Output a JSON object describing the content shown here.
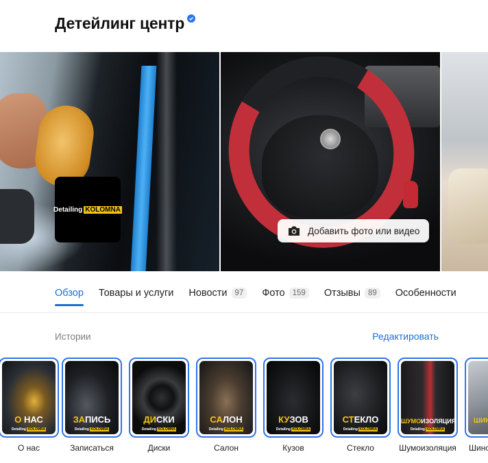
{
  "header": {
    "title": "Детейлинг центр"
  },
  "gallery": {
    "logo": {
      "text": "Detailing",
      "highlight": "KOLOMNA"
    },
    "add_media_label": "Добавить фото или видео"
  },
  "tabs": [
    {
      "label": "Обзор",
      "count": null,
      "active": true
    },
    {
      "label": "Товары и услуги",
      "count": null
    },
    {
      "label": "Новости",
      "count": "97"
    },
    {
      "label": "Фото",
      "count": "159"
    },
    {
      "label": "Отзывы",
      "count": "89"
    },
    {
      "label": "Особенности",
      "count": null
    }
  ],
  "stories": {
    "title": "Истории",
    "edit_label": "Редактировать",
    "brand_text": "Detailing",
    "brand_highlight": "KOLOMNA",
    "items": [
      {
        "label": "О нас",
        "accent": "О",
        "rest": " НАС"
      },
      {
        "label": "Записаться",
        "accent": "ЗА",
        "rest": "ПИСЬ"
      },
      {
        "label": "Диски",
        "accent": "ДИ",
        "rest": "СКИ"
      },
      {
        "label": "Салон",
        "accent": "СА",
        "rest": "ЛОН"
      },
      {
        "label": "Кузов",
        "accent": "КУ",
        "rest": "ЗОВ"
      },
      {
        "label": "Стекло",
        "accent": "СТ",
        "rest": "ЕКЛО"
      },
      {
        "label": "Шумоизоляция",
        "accent": "ШУМО",
        "rest": "ИЗОЛЯЦИЯ"
      },
      {
        "label": "Шино",
        "accent": "ШИНО",
        "rest": ""
      }
    ]
  },
  "colors": {
    "accent": "#1a6ed8",
    "story_border": "#2e73e8",
    "brand_yellow": "#f6c515",
    "verified": "#2a76f0"
  }
}
